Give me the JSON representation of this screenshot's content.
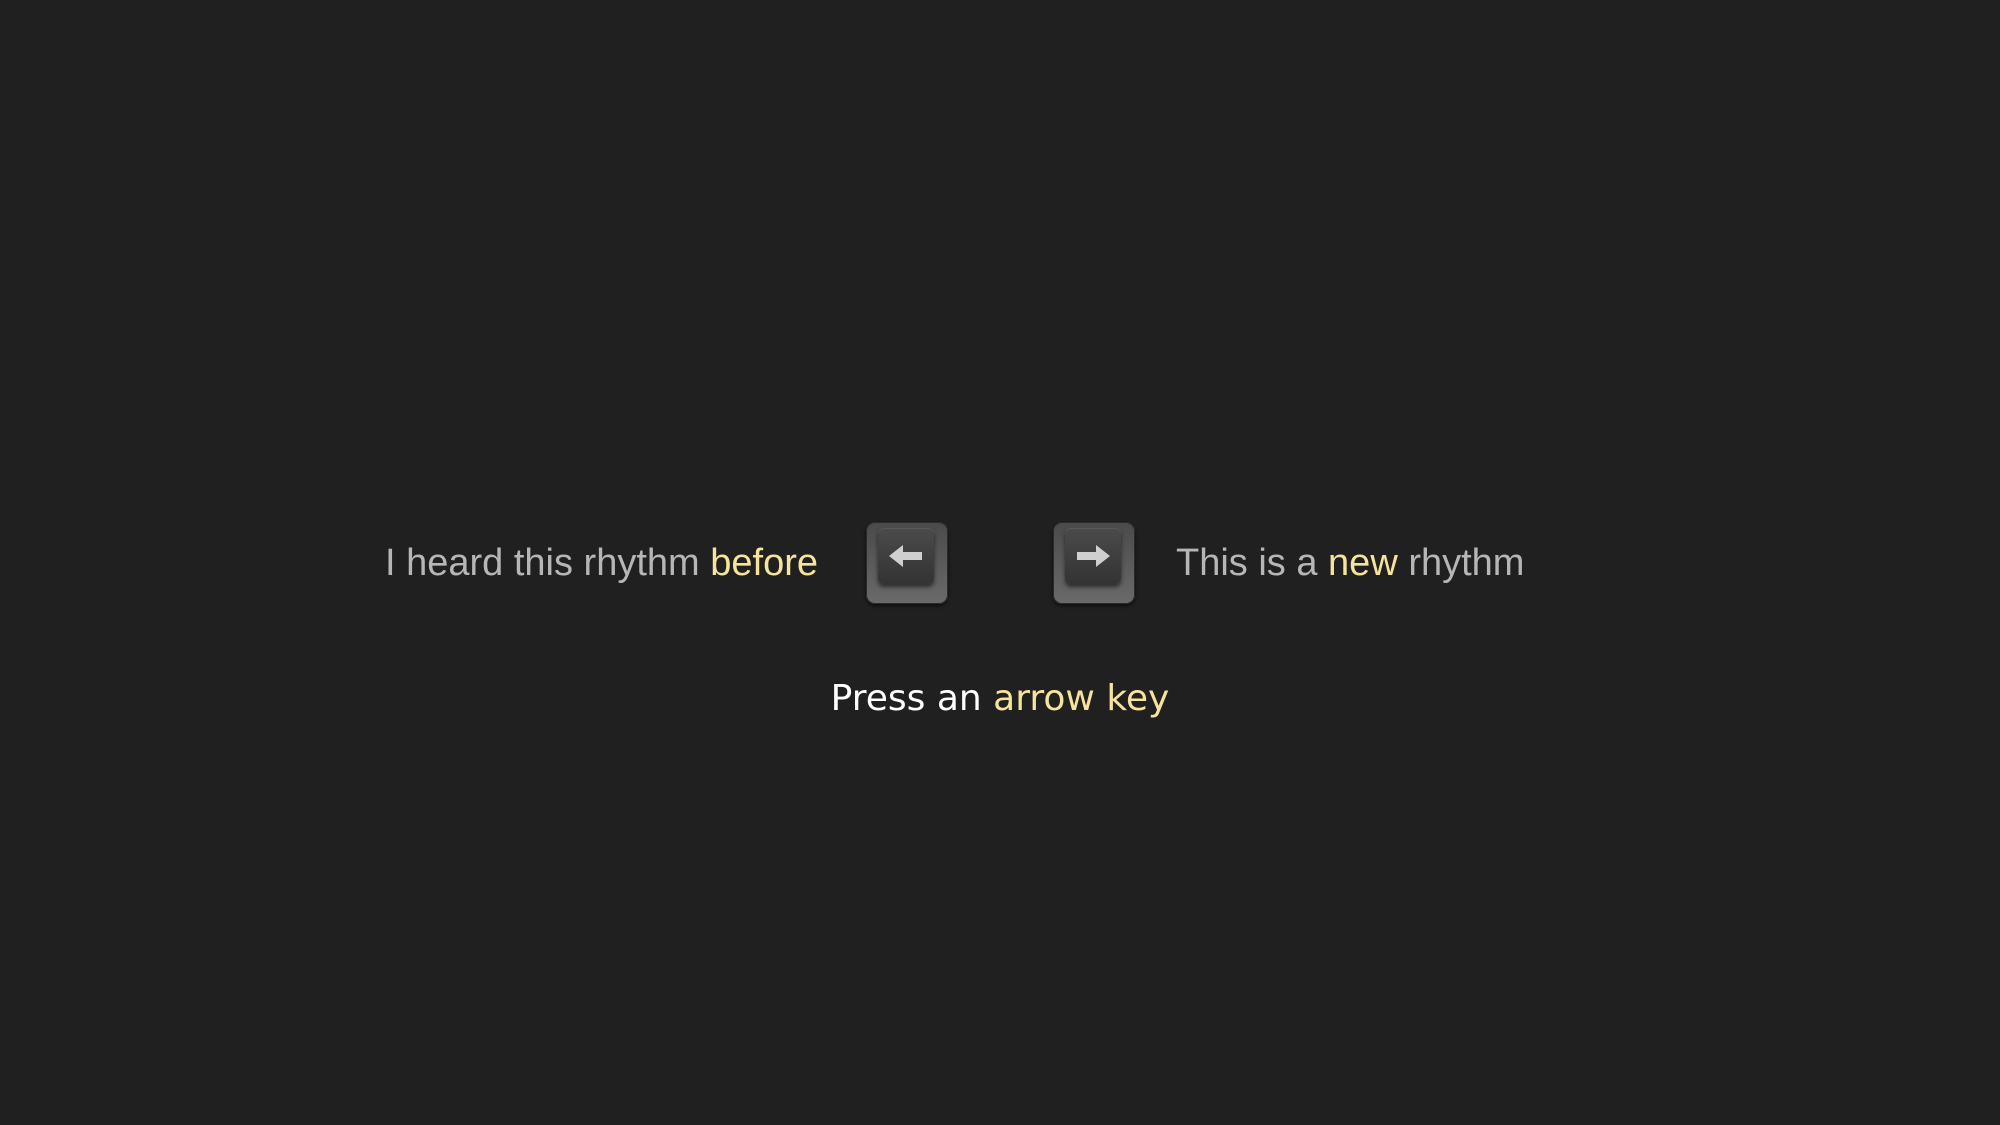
{
  "colors": {
    "background": "#202020",
    "label_text": "#b6b6b6",
    "highlight": "#f6e39c",
    "prompt_text": "#ffffff"
  },
  "left_option": {
    "prefix": "I heard this rhythm ",
    "highlight": "before",
    "key_icon": "left-arrow-icon"
  },
  "right_option": {
    "prefix": "This is a ",
    "highlight": "new",
    "suffix": " rhythm",
    "key_icon": "right-arrow-icon"
  },
  "prompt": {
    "prefix": "Press an ",
    "highlight": "arrow key"
  }
}
